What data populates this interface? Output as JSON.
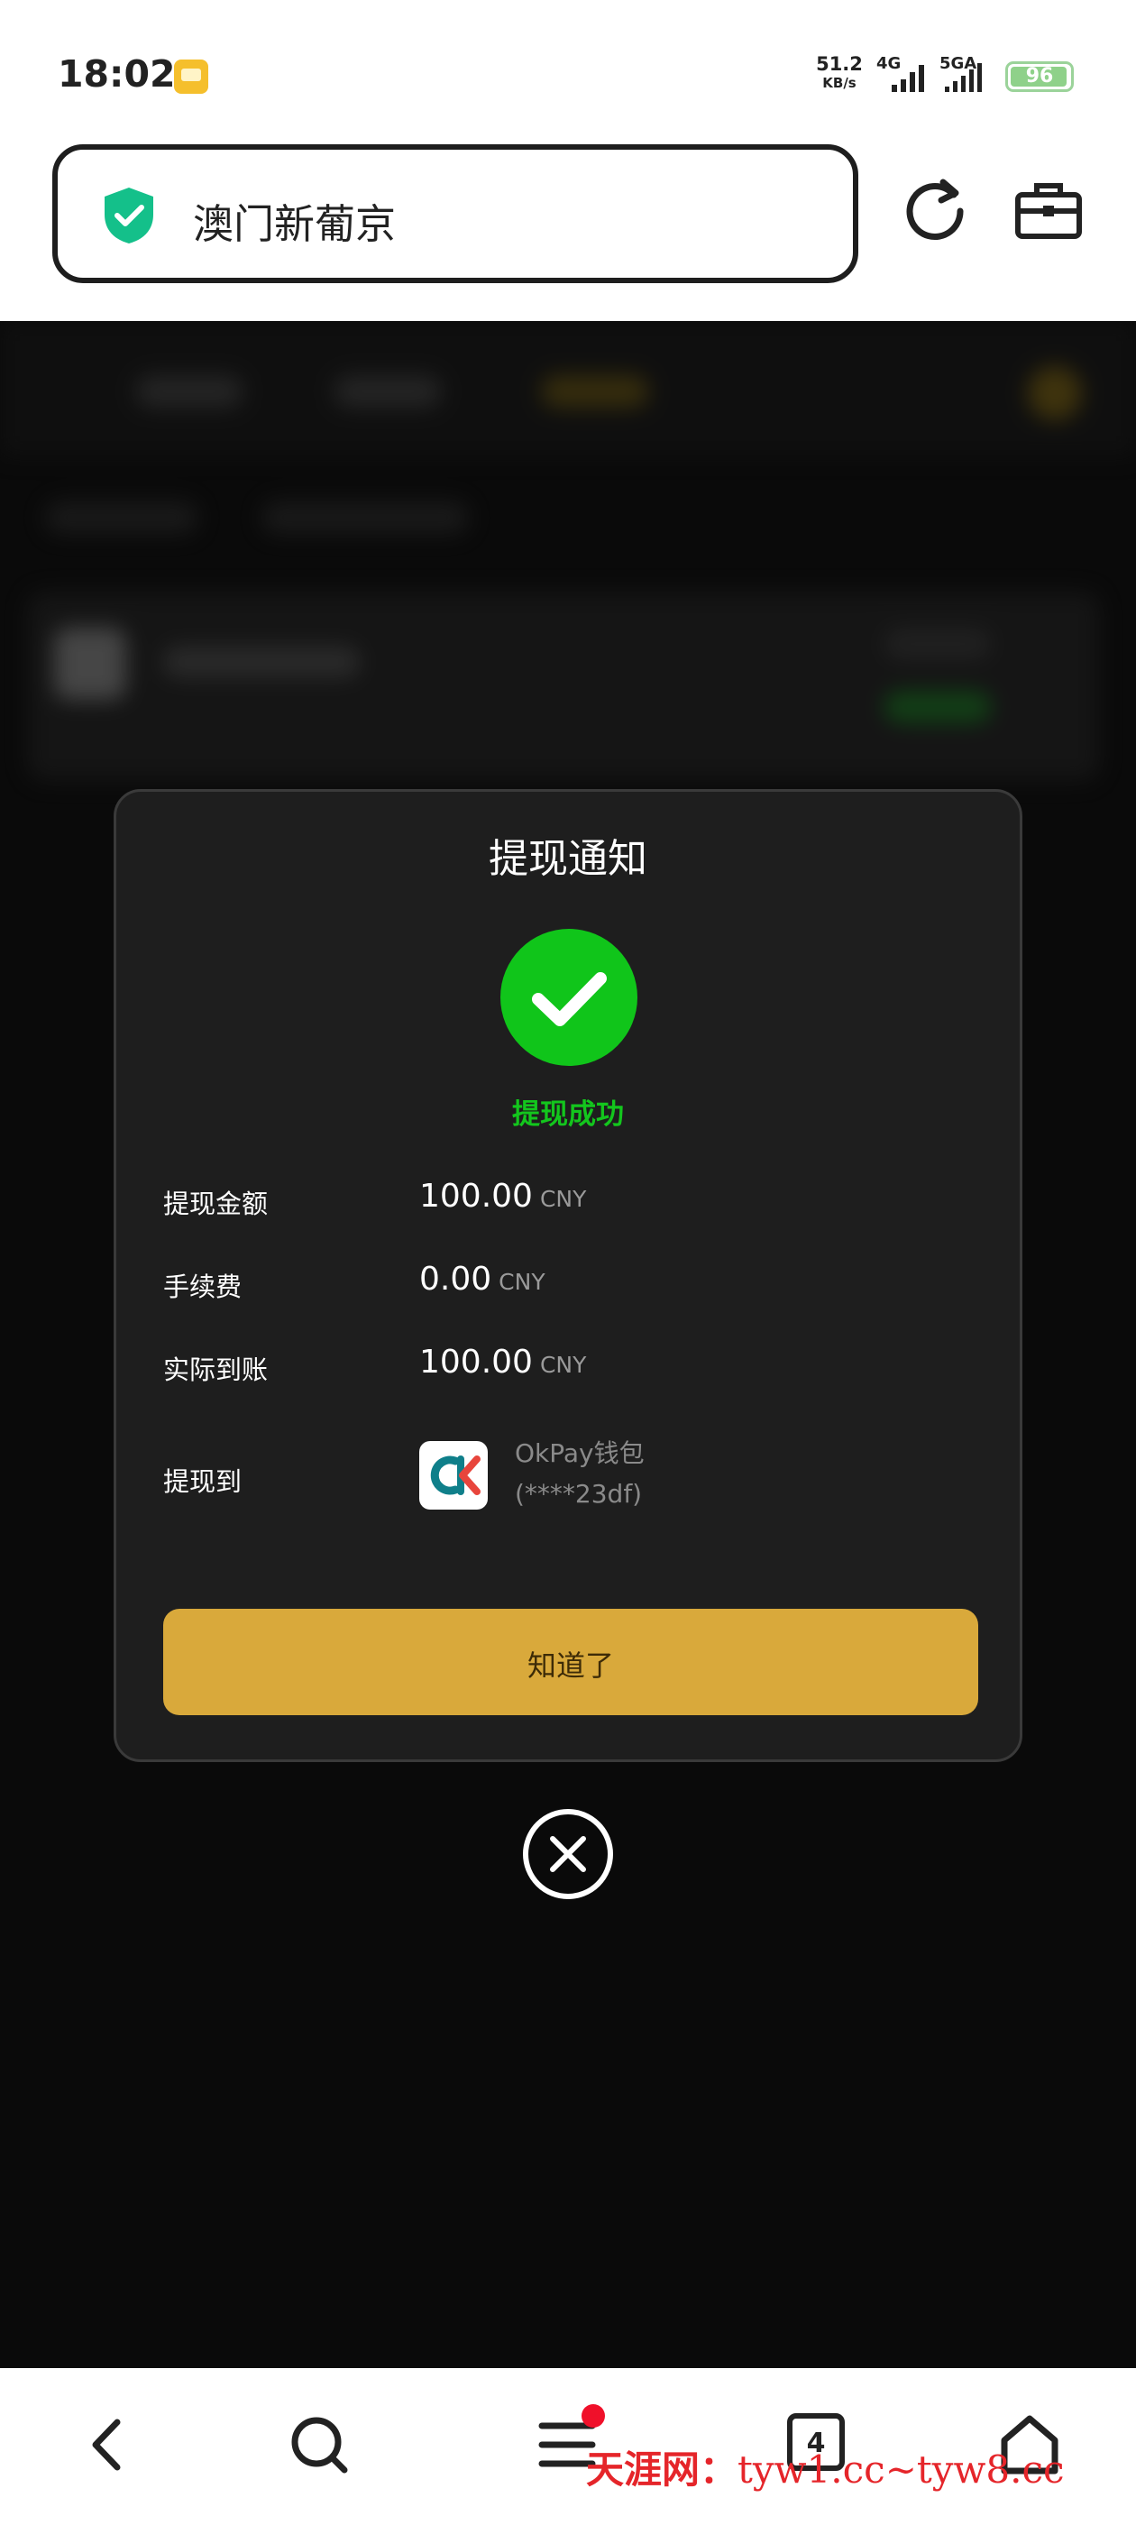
{
  "status_bar": {
    "time": "18:02",
    "net_speed_value": "51.2",
    "net_speed_unit": "KB/s",
    "network_1": "4G",
    "network_2": "5GA",
    "battery_level": "96"
  },
  "address_bar": {
    "url_text": "澳门新葡京",
    "secure_icon": "shield-check-icon",
    "reload_icon": "reload-icon",
    "toolbox_icon": "toolbox-icon"
  },
  "modal": {
    "title": "提现通知",
    "status_text": "提现成功",
    "rows": [
      {
        "label": "提现金额",
        "amount": "100.00",
        "unit": "CNY"
      },
      {
        "label": "手续费",
        "amount": "0.00",
        "unit": "CNY"
      },
      {
        "label": "实际到账",
        "amount": "100.00",
        "unit": "CNY"
      }
    ],
    "destination": {
      "label": "提现到",
      "wallet_name": "OkPay钱包",
      "account": "(****23df)",
      "logo_text": "OK"
    },
    "button_label": "知道了"
  },
  "bottom_bar": {
    "tabs_count": "4"
  },
  "watermark": {
    "name": "天涯网：",
    "url": "tyw1.cc~tyw8.cc"
  },
  "colors": {
    "success": "#10c51a",
    "button": "#d9a93b",
    "modal_bg": "#1e1e1e",
    "secure": "#14c08a"
  }
}
